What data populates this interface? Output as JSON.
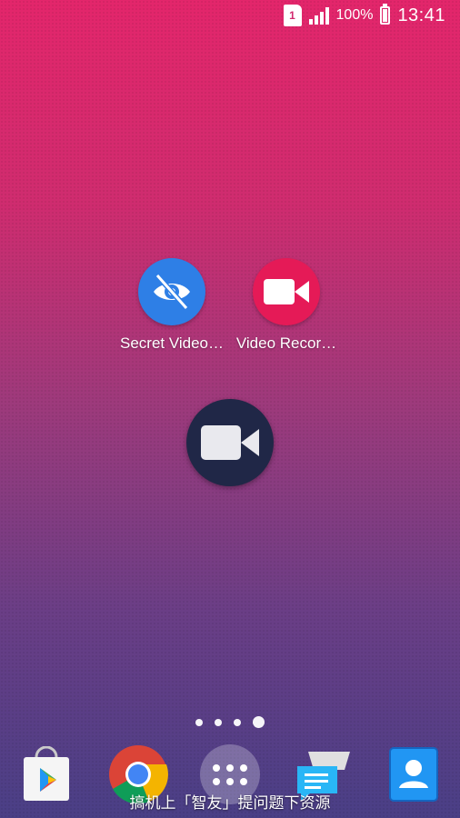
{
  "status_bar": {
    "sim_slot": "1",
    "battery_percent": "100%",
    "time": "13:41"
  },
  "home_apps": [
    {
      "label": "Secret Video…",
      "icon": "eye-slash-icon",
      "color": "#2e7fe6"
    },
    {
      "label": "Video Recor…",
      "icon": "video-camera-icon",
      "color": "#e51a57"
    }
  ],
  "floating_widget": {
    "icon": "video-camera-icon",
    "color": "#202747"
  },
  "page_indicator": {
    "total": 4,
    "active_index": 3
  },
  "dock": [
    {
      "name": "play-store-icon"
    },
    {
      "name": "chrome-icon"
    },
    {
      "name": "app-drawer-icon"
    },
    {
      "name": "messages-icon"
    },
    {
      "name": "contacts-icon"
    }
  ],
  "watermark": {
    "text": "搞机上「智友」提问题下资源"
  }
}
